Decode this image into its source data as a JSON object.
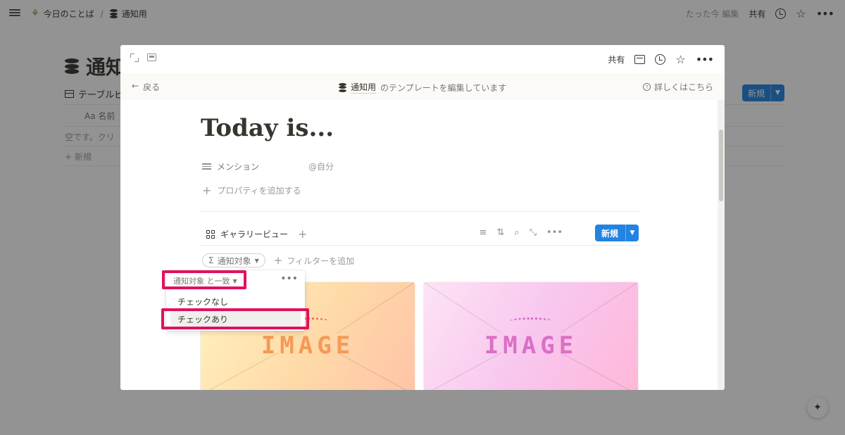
{
  "topbar": {
    "breadcrumb_parent": "今日のことば",
    "breadcrumb_sep": "/",
    "breadcrumb_current": "通知用",
    "edited": "たった今 編集",
    "share": "共有",
    "icons": [
      "menu-icon",
      "sprout-icon",
      "database-icon",
      "clock-icon",
      "star-icon"
    ]
  },
  "background_page": {
    "title": "通知",
    "view_tab": "テーブルビ",
    "column_name": "Aa 名前",
    "empty_text": "空です。クリ",
    "new_row": "+ 新規",
    "new_button": "新規"
  },
  "modal": {
    "share": "共有",
    "template_bar": {
      "back": "戻る",
      "db_name": "通知用",
      "editing_text": "のテンプレートを編集しています",
      "learn_more": "詳しくはこちら"
    },
    "page_title": "Today is...",
    "property": {
      "name": "メンション",
      "value": "@自分"
    },
    "add_property": "プロパティを追加する",
    "view": {
      "tab_label": "ギャラリービュー",
      "new_button": "新規"
    },
    "filter": {
      "chip_label": "通知対象",
      "add_filter": "フィルターを追加"
    },
    "cards": [
      {
        "word": "IMAGE",
        "accent": "#f59a57"
      },
      {
        "word": "IMAGE",
        "accent": "#dc6fc6"
      }
    ]
  },
  "dropdown": {
    "condition": "通知対象 と一致",
    "options": [
      "チェックなし",
      "チェックあり"
    ],
    "selected": "チェックあり"
  },
  "colors": {
    "accent_blue": "#2383e2",
    "highlight": "#e0115f"
  }
}
